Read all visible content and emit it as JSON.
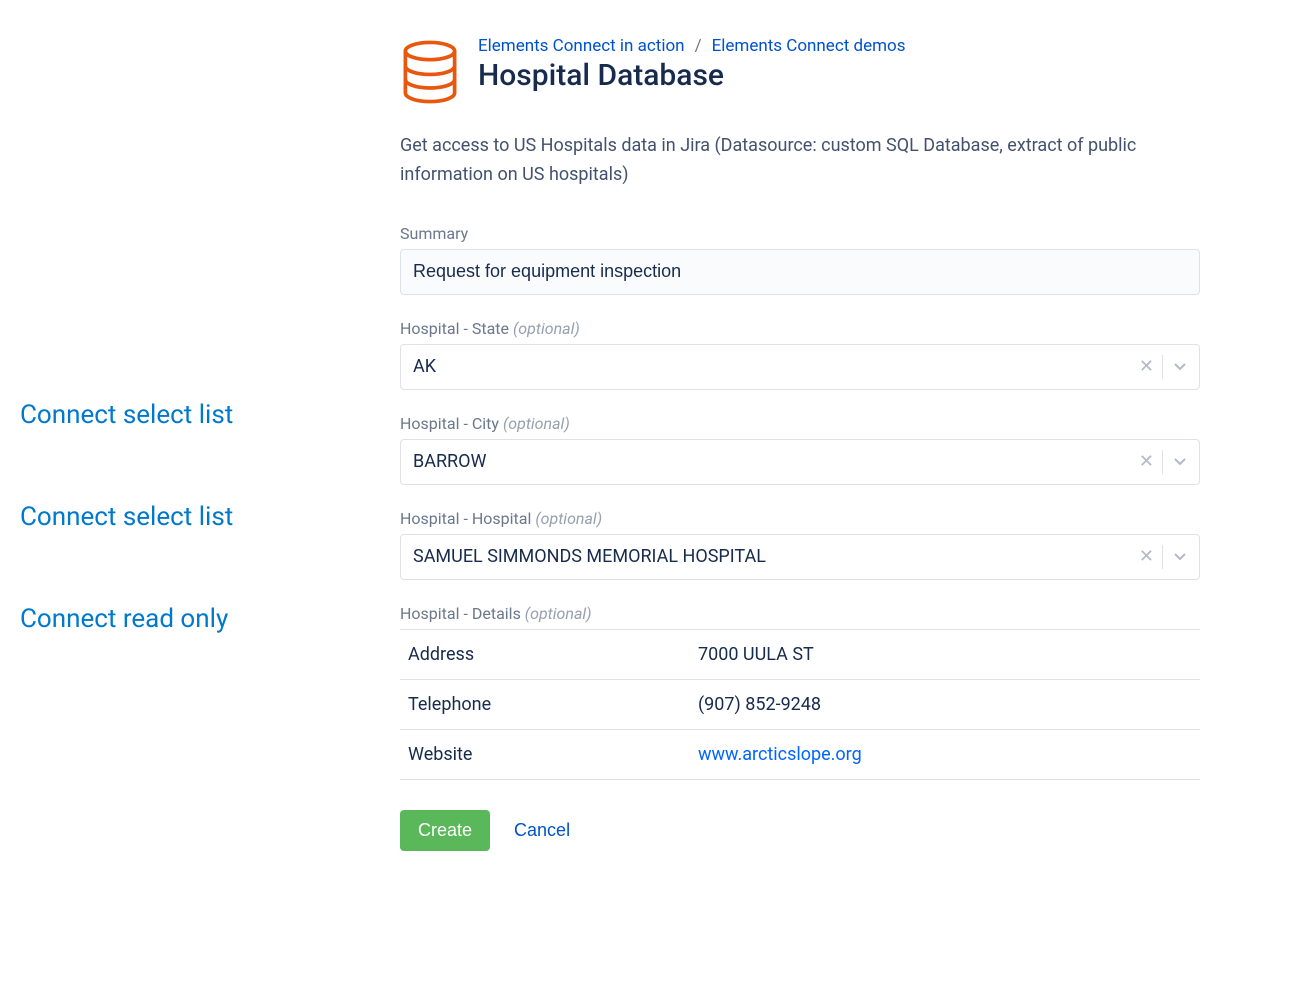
{
  "header": {
    "breadcrumbs": [
      "Elements Connect in action",
      "Elements Connect demos"
    ],
    "breadcrumb_sep": "/",
    "title": "Hospital Database",
    "description": "Get access to US Hospitals data in Jira (Datasource: custom SQL Database, extract of public information on US hospitals)"
  },
  "icons": {
    "database": "database-icon",
    "clear": "✕"
  },
  "labels": {
    "optional": "(optional)"
  },
  "fields": {
    "summary": {
      "label": "Summary",
      "value": "Request for equipment inspection"
    },
    "state": {
      "label": "Hospital - State",
      "optional": true,
      "value": "AK"
    },
    "city": {
      "label": "Hospital - City",
      "optional": true,
      "value": "BARROW"
    },
    "hospital": {
      "label": "Hospital - Hospital",
      "optional": true,
      "value": "SAMUEL SIMMONDS MEMORIAL HOSPITAL"
    },
    "details": {
      "label": "Hospital - Details",
      "optional": true,
      "rows": [
        {
          "k": "Address",
          "v": "7000 UULA ST"
        },
        {
          "k": "Telephone",
          "v": "(907) 852-9248"
        },
        {
          "k": "Website",
          "v": "www.arcticslope.org",
          "link": true
        }
      ]
    }
  },
  "actions": {
    "create": "Create",
    "cancel": "Cancel"
  },
  "annotations": {
    "state": "Connect select list",
    "city": "Connect select list",
    "hospital": "Connect read only"
  }
}
